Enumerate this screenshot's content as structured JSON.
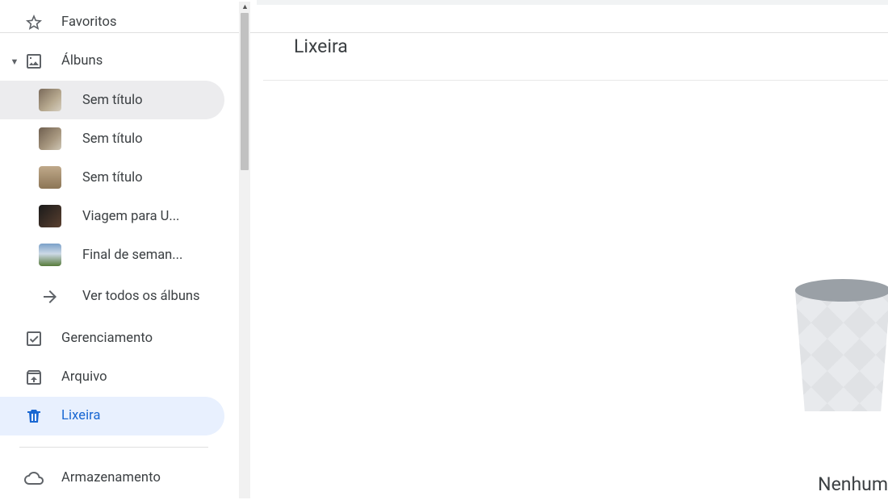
{
  "sidebar": {
    "favorites_label": "Favoritos",
    "albums_label": "Álbuns",
    "albums": [
      {
        "label": "Sem título"
      },
      {
        "label": "Sem título"
      },
      {
        "label": "Sem título"
      },
      {
        "label": "Viagem para U..."
      },
      {
        "label": "Final de seman..."
      }
    ],
    "see_all_albums": "Ver todos os álbuns",
    "management_label": "Gerenciamento",
    "archive_label": "Arquivo",
    "trash_label": "Lixeira",
    "storage_label": "Armazenamento"
  },
  "main": {
    "title": "Lixeira",
    "empty_text": "Nenhum"
  }
}
